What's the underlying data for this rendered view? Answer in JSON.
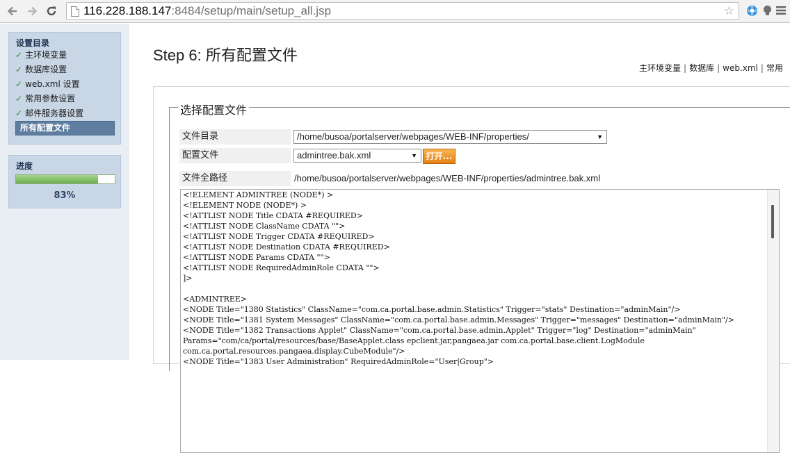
{
  "browser": {
    "url_host": "116.228.188.147",
    "url_rest": ":8484/setup/main/setup_all.jsp",
    "icons": [
      "back-icon",
      "forward-icon",
      "reload-icon",
      "page-icon",
      "bookmark-star-icon",
      "extension-flower-icon",
      "extension-bulb-icon",
      "menu-icon"
    ]
  },
  "sidebar": {
    "steps_title": "设置目录",
    "steps": [
      {
        "label": "主环境变量",
        "done": true
      },
      {
        "label": "数据库设置",
        "done": true
      },
      {
        "label": "web.xml 设置",
        "done": true
      },
      {
        "label": "常用参数设置",
        "done": true
      },
      {
        "label": "邮件服务器设置",
        "done": true
      },
      {
        "label": "所有配置文件",
        "done": false,
        "active": true
      }
    ],
    "check_mark": "✓",
    "progress_title": "进度",
    "progress_percent": 83,
    "progress_text": "83%"
  },
  "main": {
    "step_title": "Step 6: 所有配置文件",
    "quick_links": [
      "主环境变量",
      "数据库",
      "web.xml",
      "常用"
    ],
    "legend": "选择配置文件",
    "dir_label": "文件目录",
    "dir_value": "/home/busoa/portalserver/webpages/WEB-INF/properties/",
    "file_label": "配置文件",
    "file_value": "admintree.bak.xml",
    "open_button": "打开...",
    "fullpath_label": "文件全路径",
    "fullpath_value": "/home/busoa/portalserver/webpages/WEB-INF/properties/admintree.bak.xml",
    "file_content": "<!ELEMENT ADMINTREE (NODE*) >\n<!ELEMENT NODE (NODE*) >\n<!ATTLIST NODE Title CDATA #REQUIRED>\n<!ATTLIST NODE ClassName CDATA \"\">\n<!ATTLIST NODE Trigger CDATA #REQUIRED>\n<!ATTLIST NODE Destination CDATA #REQUIRED>\n<!ATTLIST NODE Params CDATA \"\">\n<!ATTLIST NODE RequiredAdminRole CDATA \"\">\n]>\n\n<ADMINTREE>\n<NODE Title=\"1380 Statistics\" ClassName=\"com.ca.portal.base.admin.Statistics\" Trigger=\"stats\" Destination=\"adminMain\"/>\n<NODE Title=\"1381 System Messages\" ClassName=\"com.ca.portal.base.admin.Messages\" Trigger=\"messages\" Destination=\"adminMain\"/>\n<NODE Title=\"1382 Transactions Applet\" ClassName=\"com.ca.portal.base.admin.Applet\" Trigger=\"log\" Destination=\"adminMain\"\nParams=\"com/ca/portal/resources/base/BaseApplet.class epclient.jar,pangaea.jar com.ca.portal.base.client.LogModule\ncom.ca.portal.resources.pangaea.display.CubeModule\"/>\n<NODE Title=\"1383 User Administration\" RequiredAdminRole=\"User|Group\">"
  },
  "colors": {
    "sidebar_bg": "#e9eef4",
    "panel_bg": "#c9d6e6",
    "active_step_bg": "#5f7d9f",
    "progress_fill": "#69ad4f",
    "open_button": "#e57f14"
  }
}
